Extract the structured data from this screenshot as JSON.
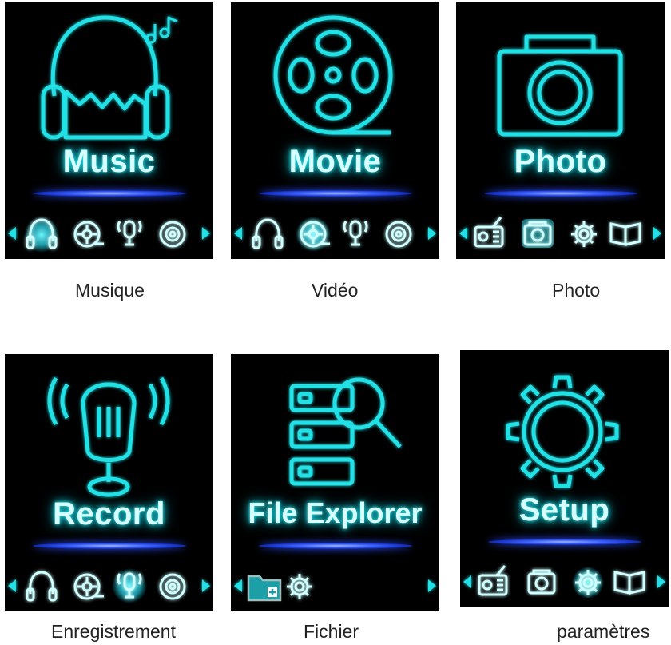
{
  "screens": [
    {
      "title": "Music",
      "caption": "Musique"
    },
    {
      "title": "Movie",
      "caption": "Vidéo"
    },
    {
      "title": "Photo",
      "caption": "Photo"
    },
    {
      "title": "Record",
      "caption": "Enregistrement"
    },
    {
      "title": "File Explorer",
      "caption": "Fichier"
    },
    {
      "title": "Setup",
      "caption": "paramètres"
    }
  ],
  "colors": {
    "neon": "#21e1e6",
    "screen_bg": "#000000",
    "page_bg": "#ffffff",
    "highlight_bar": "#3d63ff"
  },
  "icons": [
    "headphones-icon",
    "film-reel-icon",
    "microphone-icon",
    "disc-icon",
    "radio-icon",
    "camera-icon",
    "gear-icon",
    "book-icon",
    "folder-add-icon",
    "server-search-icon",
    "arrow-left-icon",
    "arrow-right-icon"
  ]
}
